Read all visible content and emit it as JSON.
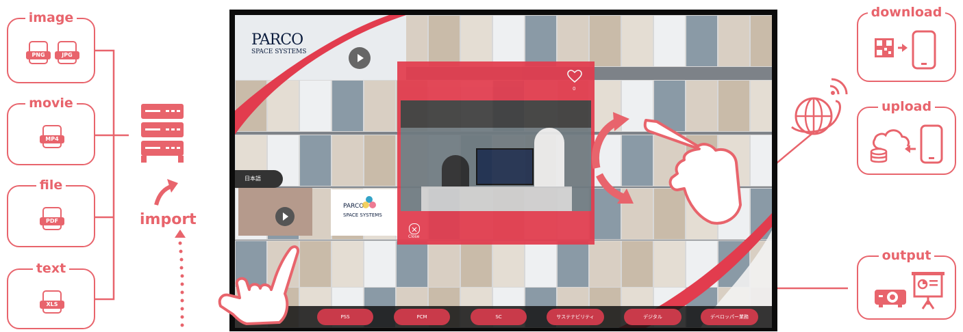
{
  "left_panels": {
    "image": {
      "label": "image",
      "badges": [
        "PNG",
        "JPG"
      ]
    },
    "movie": {
      "label": "movie",
      "badges": [
        "MP4"
      ]
    },
    "file": {
      "label": "file",
      "badges": [
        "PDF"
      ]
    },
    "text": {
      "label": "text",
      "badges": [
        "XLS"
      ]
    }
  },
  "import_label": "import",
  "screen": {
    "brand_title": "PARCO",
    "brand_subtitle": "SPACE SYSTEMS",
    "like_count": "0",
    "close_label": "Close",
    "language_label": "日本語",
    "card_logo_top": "PARCO",
    "card_logo_bottom": "SPACE SYSTEMS",
    "nav_buttons": [
      "PSS",
      "PCM",
      "SC",
      "サステナビリティ",
      "デジタル",
      "デベロッパー業務"
    ]
  },
  "right_panels": {
    "download": {
      "label": "download"
    },
    "upload": {
      "label": "upload"
    },
    "output": {
      "label": "output"
    }
  },
  "colors": {
    "accent": "#e8646c",
    "screen_red": "#e23c4e"
  }
}
